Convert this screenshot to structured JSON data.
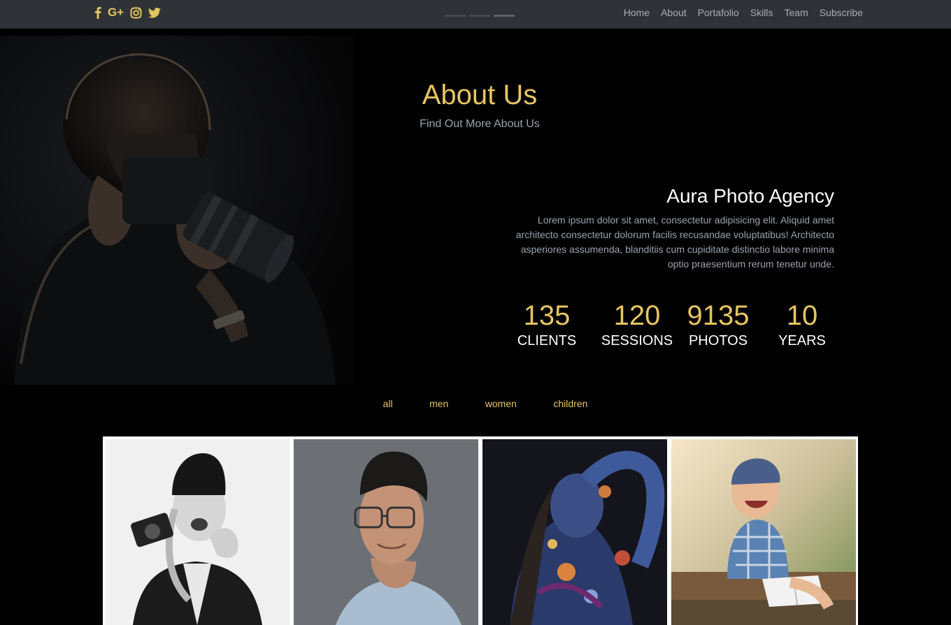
{
  "social": {
    "icons": [
      "facebook-icon",
      "google-plus-icon",
      "instagram-icon",
      "twitter-icon"
    ],
    "google_plus_text": "G+"
  },
  "slider": {
    "count": 3,
    "active_index": 2
  },
  "nav": {
    "items": [
      "Home",
      "About",
      "Portafolio",
      "Skills",
      "Team",
      "Subscribe"
    ]
  },
  "about": {
    "title": "About Us",
    "subtitle": "Find Out More About Us",
    "agency_name": "Aura Photo Agency",
    "description": "Lorem ipsum dolor sit amet, consectetur adipisicing elit. Aliquid amet architecto consectetur dolorum facilis recusandae voluptatibus! Architecto asperiores assumenda, blanditiis cum cupiditate distinctio labore minima optio praesentium rerum tenetur unde."
  },
  "stats": [
    {
      "value": "135",
      "label": "CLIENTS"
    },
    {
      "value": "120",
      "label": "SESSIONS"
    },
    {
      "value": "9135",
      "label": "PHOTOS"
    },
    {
      "value": "10",
      "label": "YEARS"
    }
  ],
  "filters": [
    "all",
    "men",
    "women",
    "children"
  ],
  "gallery": {
    "photos": [
      "woman-with-camera-photo",
      "man-with-glasses-photo",
      "body-paint-woman-photo",
      "laughing-child-photo"
    ]
  },
  "colors": {
    "accent": "#e6c560",
    "topbar_bg": "#2f3236",
    "page_bg": "#000000",
    "muted_text": "#9aa3ad",
    "nav_text": "#a9adb2"
  }
}
